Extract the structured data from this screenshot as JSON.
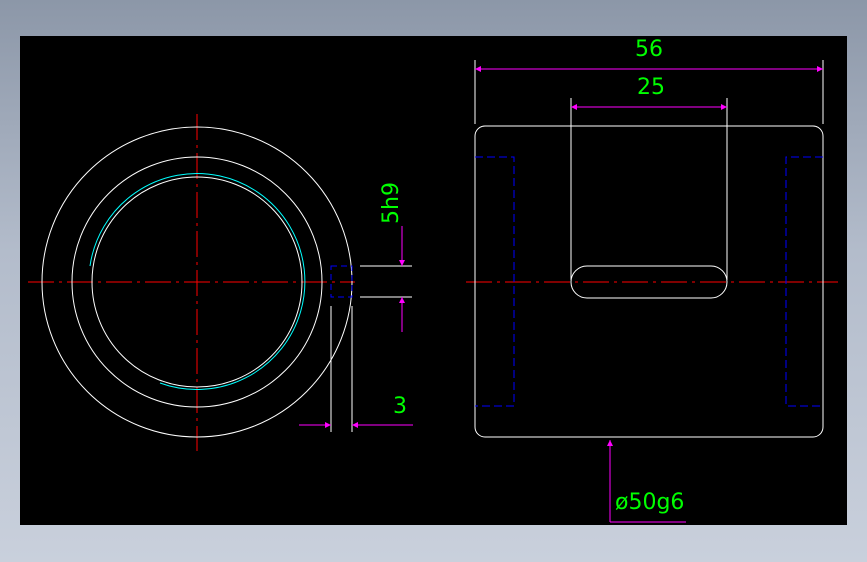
{
  "colors": {
    "background": "#000000",
    "outline": "#ffffff",
    "centerline": "#ff0000",
    "dimension_line": "#ff00ff",
    "dimension_text": "#00ff00",
    "hidden_line": "#0000ff",
    "thread_arc": "#00ffff"
  },
  "dimensions": {
    "overall_length": "56",
    "slot_length": "25",
    "key_width": "5h9",
    "key_depth": "3",
    "outer_diameter": "ø50g6"
  }
}
